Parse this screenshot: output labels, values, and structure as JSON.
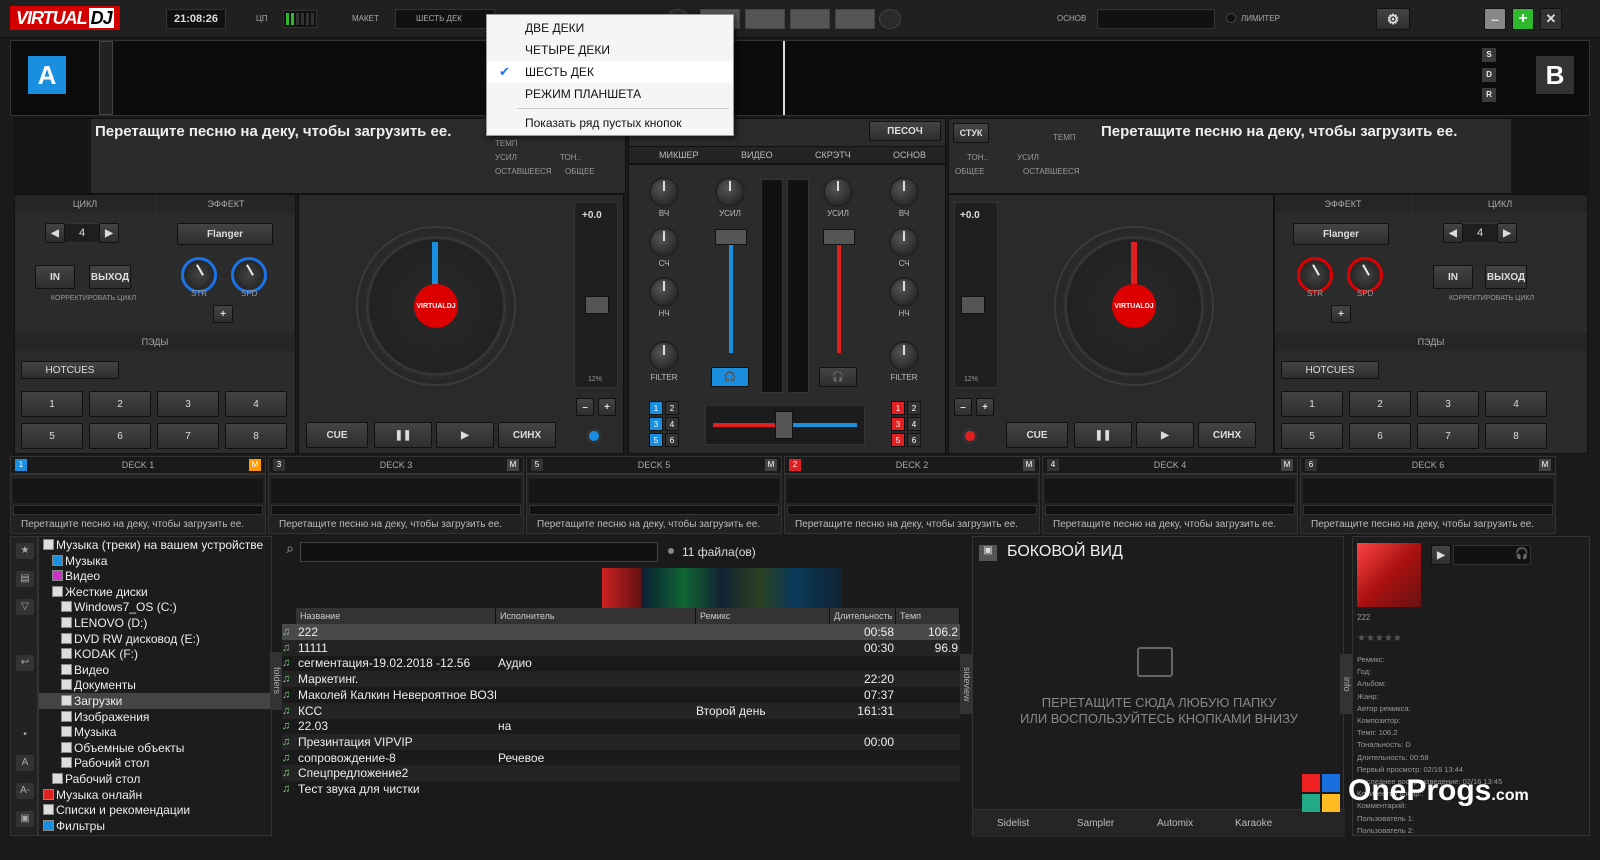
{
  "app": {
    "logo_a": "VIRTUAL",
    "logo_b": "DJ"
  },
  "topbar": {
    "clock": "21:08:26",
    "cpu_label": "ЦП",
    "layout_label": "МАКЕТ",
    "layout_value": "ШЕСТЬ ДЕК",
    "master_label": "ОСНОВ",
    "limiter_label": "ЛИМИТЕР"
  },
  "layout_menu": {
    "items": [
      {
        "label": "ДВЕ ДЕКИ",
        "checked": false
      },
      {
        "label": "ЧЕТЫРЕ ДЕКИ",
        "checked": false
      },
      {
        "label": "ШЕСТЬ ДЕК",
        "checked": true
      },
      {
        "label": "РЕЖИМ ПЛАНШЕТА",
        "checked": false
      }
    ],
    "extra": "Показать ряд пустых кнопок"
  },
  "deck_a": {
    "letter": "A",
    "drop_text": "Перетащите песню на деку, чтобы загрузить ее.",
    "gain": "УСИЛ",
    "key": "ТОН..",
    "remain": "ОСТАВШЕЕСЯ",
    "total": "ОБЩЕЕ",
    "tempo": "ТЕМП",
    "loop_hdr": "ЦИКЛ",
    "loop_value": "4",
    "in": "IN",
    "out": "ВЫХОД",
    "loop_adjust": "КОРРЕКТИРОВАТЬ ЦИКЛ",
    "fx_hdr": "ЭФФЕКТ",
    "fx_name": "Flanger",
    "str": "STR",
    "spd": "SPD",
    "pads_hdr": "ПЭДЫ",
    "pads_mode": "HOTCUES",
    "pads": [
      "1",
      "2",
      "3",
      "4",
      "5",
      "6",
      "7",
      "8"
    ],
    "pitch": "+0.0",
    "pitch_range": "12%",
    "cue": "CUE",
    "sync": "СИНХ"
  },
  "deck_b": {
    "letter": "B",
    "drop_text": "Перетащите песню на деку, чтобы загрузить ее.",
    "gain": "УСИЛ",
    "key": "ТОН..",
    "remain": "ОСТАВШЕЕСЯ",
    "total": "ОБЩЕЕ",
    "tempo": "ТЕМП",
    "beat": "СТУК",
    "loop_hdr": "ЦИКЛ",
    "loop_value": "4",
    "in": "IN",
    "out": "ВЫХОД",
    "loop_adjust": "КОРРЕКТИРОВАТЬ ЦИКЛ",
    "fx_hdr": "ЭФФЕКТ",
    "fx_name": "Flanger",
    "str": "STR",
    "spd": "SPD",
    "pads_hdr": "ПЭДЫ",
    "pads_mode": "HOTCUES",
    "pads": [
      "1",
      "2",
      "3",
      "4",
      "5",
      "6",
      "7",
      "8"
    ],
    "pitch": "+0.0",
    "pitch_range": "12%",
    "cue": "CUE",
    "sync": "СИНХ"
  },
  "wave": {
    "sdr": [
      "S",
      "D",
      "R"
    ]
  },
  "mixer": {
    "sandbox": "ПЕСОЧ",
    "tabs": [
      "МИКШЕР",
      "ВИДЕО",
      "СКРЭТЧ",
      "ОСНОВ"
    ],
    "gain": "УСИЛ",
    "eq": [
      "ВЧ",
      "СЧ",
      "НЧ"
    ],
    "filter": "FILTER",
    "left_decks": [
      "1",
      "2",
      "3",
      "4",
      "5",
      "6"
    ],
    "right_decks": [
      "1",
      "2",
      "3",
      "4",
      "5",
      "6"
    ]
  },
  "decks_strip": [
    {
      "num": "1",
      "name": "DECK 1",
      "m": "M",
      "msg": "Перетащите песню на деку, чтобы загрузить ее."
    },
    {
      "num": "3",
      "name": "DECK 3",
      "m": "M",
      "msg": "Перетащите песню на деку, чтобы загрузить ее."
    },
    {
      "num": "5",
      "name": "DECK 5",
      "m": "M",
      "msg": "Перетащите песню на деку, чтобы загрузить ее."
    },
    {
      "num": "2",
      "name": "DECK 2",
      "m": "M",
      "msg": "Перетащите песню на деку, чтобы загрузить ее."
    },
    {
      "num": "4",
      "name": "DECK 4",
      "m": "M",
      "msg": "Перетащите песню на деку, чтобы загрузить ее."
    },
    {
      "num": "6",
      "name": "DECK 6",
      "m": "M",
      "msg": "Перетащите песню на деку, чтобы загрузить ее."
    }
  ],
  "browser": {
    "tree": [
      {
        "label": "Музыка (треки) на вашем устройстве",
        "indent": 0
      },
      {
        "label": "Музыка",
        "indent": 1
      },
      {
        "label": "Видео",
        "indent": 1
      },
      {
        "label": "Жесткие диски",
        "indent": 1
      },
      {
        "label": "Windows7_OS (C:)",
        "indent": 2
      },
      {
        "label": "LENOVO (D:)",
        "indent": 2
      },
      {
        "label": "DVD RW дисковод (E:)",
        "indent": 2
      },
      {
        "label": "KODAK (F:)",
        "indent": 2
      },
      {
        "label": "Видео",
        "indent": 2
      },
      {
        "label": "Документы",
        "indent": 2
      },
      {
        "label": "Загрузки",
        "indent": 2
      },
      {
        "label": "Изображения",
        "indent": 2
      },
      {
        "label": "Музыка",
        "indent": 2
      },
      {
        "label": "Объемные объекты",
        "indent": 2
      },
      {
        "label": "Рабочий стол",
        "indent": 2
      },
      {
        "label": "Рабочий стол",
        "indent": 1
      },
      {
        "label": "Музыка онлайн",
        "indent": 0
      },
      {
        "label": "Списки и рекомендации",
        "indent": 0
      },
      {
        "label": "Фильтры",
        "indent": 0
      }
    ],
    "file_count": "11 файла(ов)",
    "folders_tab": "folders",
    "sideview_tab": "sideview",
    "info_tab": "info",
    "columns": [
      "Название",
      "Исполнитель",
      "Ремикс",
      "Длительность",
      "Темп"
    ],
    "rows": [
      {
        "title": "222",
        "artist": "",
        "remix": "",
        "dur": "00:58",
        "bpm": "106.2"
      },
      {
        "title": "11111",
        "artist": "",
        "remix": "",
        "dur": "00:30",
        "bpm": "96.9"
      },
      {
        "title": "сегментация-19.02.2018 -12.56",
        "artist": "Аудио",
        "remix": "",
        "dur": "",
        "bpm": ""
      },
      {
        "title": "Маркетинг.",
        "artist": "",
        "remix": "",
        "dur": "22:20",
        "bpm": ""
      },
      {
        "title": "Маколей Калкин Невероятное ВОЗВРАЩЕНИЕ ...",
        "artist": "",
        "remix": "",
        "dur": "07:37",
        "bpm": ""
      },
      {
        "title": "КСС",
        "artist": "",
        "remix": "Второй день",
        "dur": "161:31",
        "bpm": ""
      },
      {
        "title": "22.03",
        "artist": "на",
        "remix": "",
        "dur": "",
        "bpm": ""
      },
      {
        "title": "Презинтация VIPVIP",
        "artist": "",
        "remix": "",
        "dur": "00:00",
        "bpm": ""
      },
      {
        "title": "сопровождение-8",
        "artist": "Речевое",
        "remix": "",
        "dur": "",
        "bpm": ""
      },
      {
        "title": "Спецпредложение2",
        "artist": "",
        "remix": "",
        "dur": "",
        "bpm": ""
      },
      {
        "title": "Тест звука для чистки",
        "artist": "",
        "remix": "",
        "dur": "",
        "bpm": ""
      }
    ]
  },
  "sideview": {
    "title": "БОКОВОЙ ВИД",
    "drop_line1": "ПЕРЕТАЩИТЕ СЮДА ЛЮБУЮ ПАПКУ",
    "drop_line2": "ИЛИ ВОСПОЛЬЗУЙТЕСЬ КНОПКАМИ ВНИЗУ",
    "tabs": [
      "Sidelist",
      "Sampler",
      "Automix",
      "Karaoke"
    ]
  },
  "info": {
    "track": "222",
    "fields": [
      "Ремикс:",
      "Год:",
      "Альбом:",
      "Жанр:",
      "Автор ремикса:",
      "Композитор:",
      "Темп: 106.2",
      "Тональность: D",
      "Длительность: 00:58",
      "Первый просмотр: 02/16 13:44",
      "Последнее воспроизведение: 02/16 13:45",
      "Количество воспр.:",
      "Комментарий:",
      "Пользователь 1:",
      "Пользователь 2:"
    ]
  },
  "watermark": {
    "text": "OneProgs",
    "suffix": ".com"
  },
  "colors": {
    "deck_a": "#1a8fe0",
    "deck_b": "#e02020",
    "brand": "#d40000"
  }
}
